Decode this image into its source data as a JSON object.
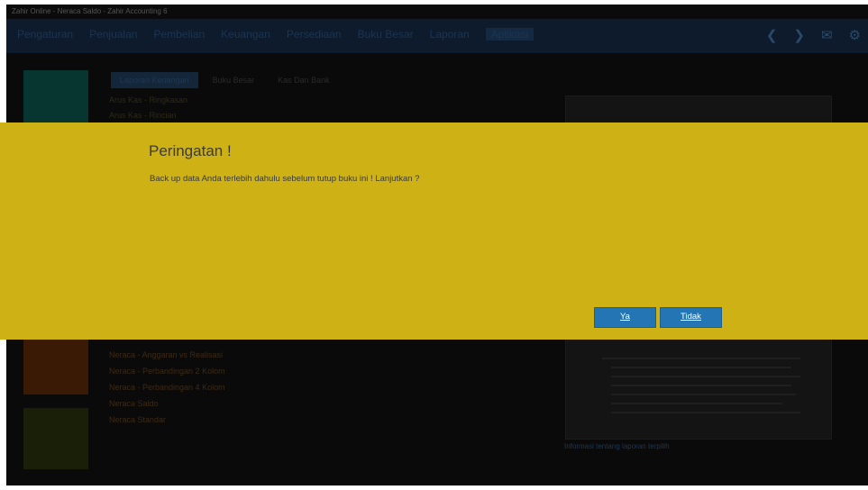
{
  "window": {
    "title": "Zahir Online - Neraca Saldo - Zahir Accounting 6"
  },
  "menu": {
    "items": [
      "Pengaturan",
      "Penjualan",
      "Pembelian",
      "Keuangan",
      "Persediaan",
      "Buku Besar",
      "Laporan",
      "Aplikasi"
    ],
    "active_index": 7
  },
  "tabs": [
    "Laporan Keuangan",
    "Buku Besar",
    "Kas Dan Bank"
  ],
  "reports_top": [
    "Arus Kas - Ringkasan",
    "Arus Kas - Rincian"
  ],
  "reports_bottom": [
    "Neraca - Anggaran vs Realisasi",
    "Neraca - Perbandingan 2 Kolom",
    "Neraca - Perbandingan 4 Kolom",
    "Neraca Saldo",
    "Neraca Standar"
  ],
  "preview_caption": "Informasi tentang laporan terpilih",
  "dialog": {
    "title": "Peringatan !",
    "message": "Back up data Anda terlebih dahulu sebelum tutup buku ini ! Lanjutkan ?",
    "yes_label": "Ya",
    "no_label": "Tidak"
  },
  "colors": {
    "dialog_bg": "#cdb115",
    "button": "#2376b3"
  }
}
